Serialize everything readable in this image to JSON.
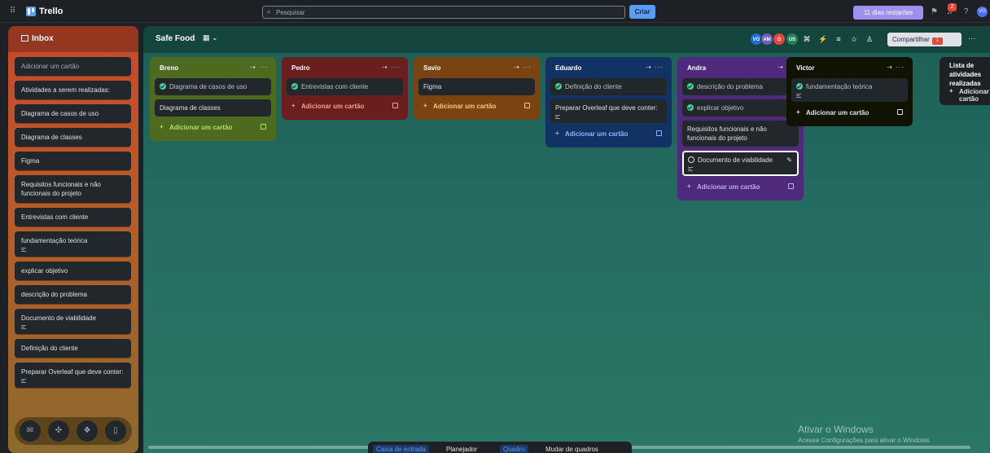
{
  "topbar": {
    "app_name": "Trello",
    "search_placeholder": "Pesquisar",
    "create_label": "Criar",
    "trial_label": "11 dias restantes",
    "notif_count": "2",
    "user_initials": "VG"
  },
  "inbox": {
    "title": "Inbox",
    "add_label": "Adicionar um cartão",
    "cards": [
      {
        "text": "Atividades a serem realizadas:",
        "has_desc": false
      },
      {
        "text": "Diagrama de casos de uso",
        "has_desc": false
      },
      {
        "text": "Diagrama de classes",
        "has_desc": false
      },
      {
        "text": "Figma",
        "has_desc": false
      },
      {
        "text": "Requisitos funcionais e não funcionais do projeto",
        "has_desc": false
      },
      {
        "text": "Entrevistas com cliente",
        "has_desc": false
      },
      {
        "text": "fundamentação teórica",
        "has_desc": true
      },
      {
        "text": "explicar objetivo",
        "has_desc": false
      },
      {
        "text": "descrição do problema",
        "has_desc": false
      },
      {
        "text": "Documento de viabilidade",
        "has_desc": true
      },
      {
        "text": "Definição do cliente",
        "has_desc": false
      },
      {
        "text": "Preparar Overleaf que deve conter:",
        "has_desc": true
      }
    ]
  },
  "board": {
    "name": "Safe Food",
    "members": [
      "VG",
      "AM",
      "G",
      "US"
    ],
    "share_label": "Compartilhar",
    "share_count": "1",
    "add_card_label": "Adicionar um cartão",
    "lists": [
      {
        "title": "Breno",
        "color": "#4c6b1f",
        "accent": "#b3df72",
        "cards": [
          {
            "text": "Diagrama de casos de uso",
            "done": true
          },
          {
            "text": "Diagrama de classes",
            "done": false
          }
        ]
      },
      {
        "title": "Pedro",
        "color": "#6a1e1e",
        "accent": "#ff9c8f",
        "cards": [
          {
            "text": "Entrevistas com cliente",
            "done": true
          }
        ]
      },
      {
        "title": "Savio",
        "color": "#7a4412",
        "accent": "#fec57b",
        "cards": [
          {
            "text": "Figma",
            "done": false
          }
        ]
      },
      {
        "title": "Eduardo",
        "color": "#123263",
        "accent": "#85b8ff",
        "cards": [
          {
            "text": "Definição do cliente",
            "done": true
          },
          {
            "text": "Preparar Overleaf que deve conter:",
            "done": false,
            "has_desc": true
          }
        ]
      },
      {
        "title": "Andra",
        "color": "#4f2a7c",
        "accent": "#b8acf6",
        "cards": [
          {
            "text": "descrição do problema",
            "done": true
          },
          {
            "text": "explicar objetivo",
            "done": true
          },
          {
            "text": "Requisitos funcionais e não funcionais do projeto",
            "done": false
          },
          {
            "text": "Documento de viabilidade",
            "done": false,
            "has_desc": true,
            "selected": true
          }
        ]
      },
      {
        "title": "Victor",
        "color": "#101204",
        "accent": "#dfe1e6",
        "cards": [
          {
            "text": "fundamentação teórica",
            "done": true,
            "has_desc": true
          }
        ]
      },
      {
        "title": "Lista de atividades realizadas",
        "color": "#1d2125",
        "accent": "#dfe1e6",
        "cards": []
      }
    ]
  },
  "bottom_nav": [
    "Caixa de entrada",
    "Planejador",
    "Quadro",
    "Mudar de quadros"
  ],
  "watermark": {
    "title": "Ativar o Windows",
    "subtitle": "Acesse Configurações para ativar o Windows."
  }
}
